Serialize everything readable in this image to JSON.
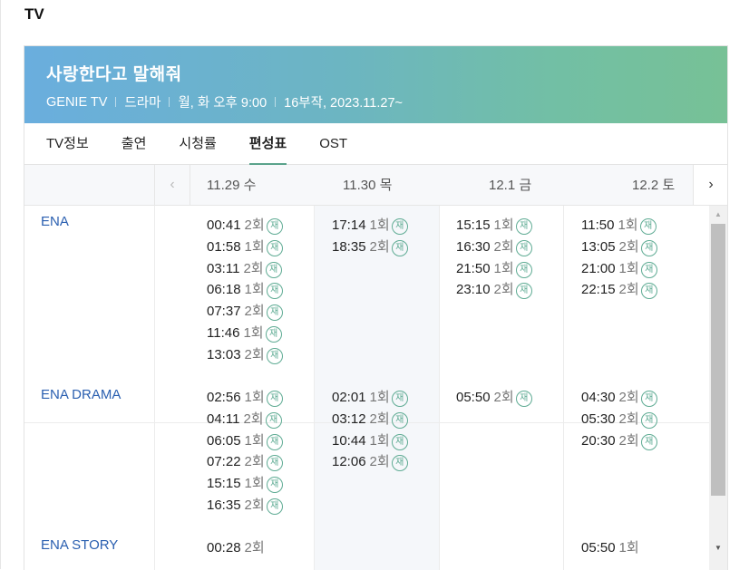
{
  "section_title": "TV",
  "show": {
    "title": "사랑한다고 말해줘",
    "meta": [
      "GENIE TV",
      "드라마",
      "월, 화 오후 9:00",
      "16부작, 2023.11.27~"
    ]
  },
  "tabs": [
    {
      "label": "TV정보"
    },
    {
      "label": "출연"
    },
    {
      "label": "시청률"
    },
    {
      "label": "편성표",
      "active": true
    },
    {
      "label": "OST"
    }
  ],
  "rerun_label": "재",
  "days": [
    "11.29 수",
    "11.30 목",
    "12.1 금",
    "12.2 토"
  ],
  "channels": [
    {
      "name": "ENA",
      "days": [
        [
          [
            "00:41",
            "2회",
            true
          ],
          [
            "01:58",
            "1회",
            true
          ],
          [
            "03:11",
            "2회",
            true
          ],
          [
            "06:18",
            "1회",
            true
          ],
          [
            "07:37",
            "2회",
            true
          ],
          [
            "11:46",
            "1회",
            true
          ],
          [
            "13:03",
            "2회",
            true
          ]
        ],
        [
          [
            "17:14",
            "1회",
            true
          ],
          [
            "18:35",
            "2회",
            true
          ]
        ],
        [
          [
            "15:15",
            "1회",
            true
          ],
          [
            "16:30",
            "2회",
            true
          ],
          [
            "21:50",
            "1회",
            true
          ],
          [
            "23:10",
            "2회",
            true
          ]
        ],
        [
          [
            "11:50",
            "1회",
            true
          ],
          [
            "13:05",
            "2회",
            true
          ],
          [
            "21:00",
            "1회",
            true
          ],
          [
            "22:15",
            "2회",
            true
          ]
        ]
      ]
    },
    {
      "name": "ENA DRAMA",
      "days": [
        [
          [
            "02:56",
            "1회",
            true
          ],
          [
            "04:11",
            "2회",
            true
          ],
          [
            "06:05",
            "1회",
            true
          ],
          [
            "07:22",
            "2회",
            true
          ],
          [
            "15:15",
            "1회",
            true
          ],
          [
            "16:35",
            "2회",
            true
          ]
        ],
        [
          [
            "02:01",
            "1회",
            true
          ],
          [
            "03:12",
            "2회",
            true
          ],
          [
            "10:44",
            "1회",
            true
          ],
          [
            "12:06",
            "2회",
            true
          ]
        ],
        [
          [
            "05:50",
            "2회",
            true
          ]
        ],
        [
          [
            "04:30",
            "2회",
            true
          ],
          [
            "05:30",
            "2회",
            true
          ],
          [
            "20:30",
            "2회",
            true
          ]
        ]
      ]
    },
    {
      "name": "ENA STORY",
      "days": [
        [
          [
            "00:28",
            "2회",
            false
          ]
        ],
        [],
        [],
        [
          [
            "05:50",
            "1회",
            false
          ]
        ]
      ]
    }
  ]
}
